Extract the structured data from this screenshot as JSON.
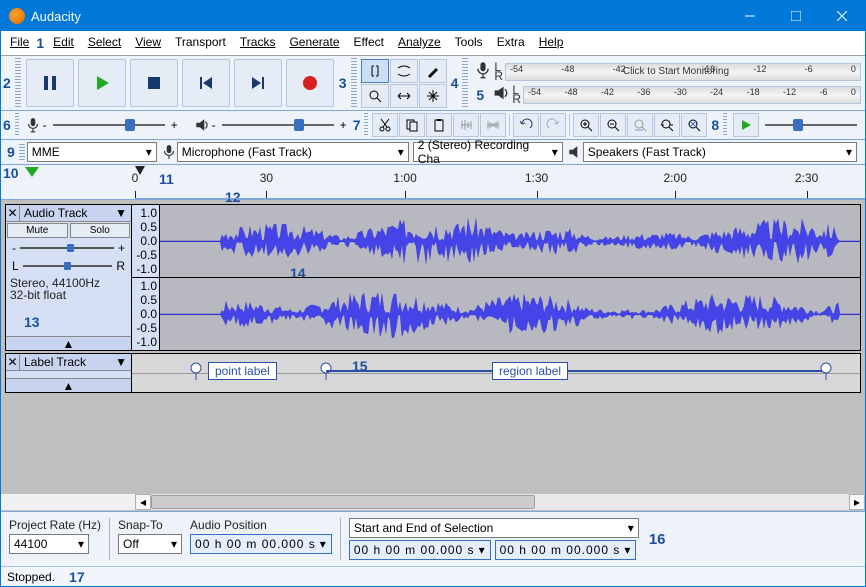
{
  "window": {
    "title": "Audacity"
  },
  "menus": [
    "File",
    "Edit",
    "Select",
    "View",
    "Transport",
    "Tracks",
    "Generate",
    "Effect",
    "Analyze",
    "Tools",
    "Extra",
    "Help"
  ],
  "annotations": {
    "menu": "1",
    "transport": "2",
    "tools": "3",
    "rec_meter": "4",
    "play_meter": "5",
    "mixer": "6",
    "edit": "7",
    "playspeed": "8",
    "device": "9",
    "pin": "10",
    "timeline": "11",
    "scrub": "12",
    "tcp": "13",
    "track": "14",
    "label": "15",
    "selection": "16",
    "status": "17"
  },
  "meter": {
    "ticks_r": [
      "-54",
      "-48",
      "-42",
      "",
      "-18",
      "-12",
      "-6",
      "0"
    ],
    "click_monitor": "Click to Start Monitoring",
    "ticks_p": [
      "-54",
      "-48",
      "-42",
      "-36",
      "-30",
      "-24",
      "-18",
      "-12",
      "-6",
      "0"
    ],
    "L": "L",
    "R": "R"
  },
  "mixer": {
    "minus": "-",
    "plus": "+"
  },
  "device": {
    "host": "MME",
    "input": "Microphone (Fast Track)",
    "channels": "2 (Stereo) Recording Cha",
    "output": "Speakers (Fast Track)"
  },
  "timeline": {
    "labels": [
      {
        "t": "0",
        "pct": 0
      },
      {
        "t": "30",
        "pct": 18
      },
      {
        "t": "1:00",
        "pct": 37
      },
      {
        "t": "1:30",
        "pct": 55
      },
      {
        "t": "2:00",
        "pct": 74
      },
      {
        "t": "2:30",
        "pct": 92
      }
    ]
  },
  "track": {
    "name": "Audio Track",
    "mute": "Mute",
    "solo": "Solo",
    "gain_minus": "-",
    "gain_plus": "+",
    "pan_l": "L",
    "pan_r": "R",
    "info1": "Stereo, 44100Hz",
    "info2": "32-bit float",
    "vscale": [
      "1.0",
      "0.5",
      "0.0",
      "-0.5",
      "-1.0"
    ]
  },
  "label_track": {
    "name": "Label Track",
    "point": "point label",
    "region": "region label"
  },
  "selection": {
    "rate_lbl": "Project Rate (Hz)",
    "rate": "44100",
    "snap_lbl": "Snap-To",
    "snap": "Off",
    "pos_lbl": "Audio Position",
    "pos": "00 h 00 m 00.000 s",
    "range_lbl": "Start and End of Selection",
    "start": "00 h 00 m 00.000 s",
    "end": "00 h 00 m 00.000 s"
  },
  "status": {
    "text": "Stopped."
  }
}
